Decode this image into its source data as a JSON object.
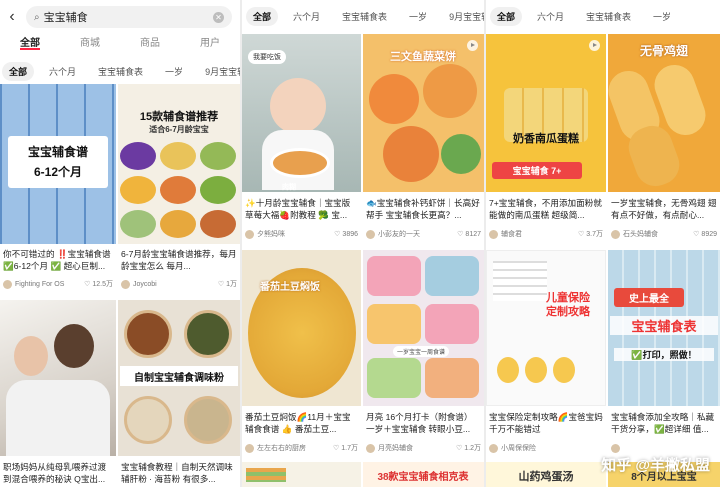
{
  "search": {
    "value": "宝宝辅食"
  },
  "tabs": [
    "全部",
    "商城",
    "商品",
    "用户"
  ],
  "chips": [
    "全部",
    "六个月",
    "宝宝辅食表",
    "一岁",
    "9月宝宝辅"
  ],
  "cards": {
    "c1": {
      "overlay": "宝宝辅食谱\n6-12个月",
      "caption": "你不可错过的 ‼️宝宝辅食谱 ✅6-12个月 ✅ 超心巨制...",
      "author": "Fighting For OS",
      "likes": "12.5万"
    },
    "c2": {
      "overlay": "15款辅食谱推荐",
      "overlay2": "适合6-7月龄宝宝",
      "caption": "6-7月龄宝宝辅食谱推荐，每月龄宝宝怎么 每月...",
      "author": "Joycobi",
      "likes": "1万"
    },
    "c3": {
      "caption": "职场妈妈从纯母乳喂养过渡到混合喂养的秘诀 Q宝出...",
      "author": "",
      "likes": ""
    },
    "c4": {
      "overlay": "自制宝宝辅食调味粉",
      "caption": "宝宝辅食教程｜自制天然调味辅肝粉 · 海苔粉 有很多...",
      "author": "",
      "likes": ""
    },
    "c5": {
      "bubble": "我要吃饭",
      "tag": "肉糊",
      "caption": "✨十月龄宝宝辅食｜宝宝版草莓大福🍓附教程 🥦 宝...",
      "author": "夕熊妈咪",
      "likes": "3896"
    },
    "c6": {
      "overlay": "三文鱼蔬菜饼",
      "caption": "🐟宝宝辅食补钙虾饼｜长高好帮手 宝宝辅食长更高？...",
      "author": "小彭友的一天",
      "likes": "8127"
    },
    "c7": {
      "overlay": "番茄土豆焖饭",
      "caption": "番茄土豆焖饭🌈11月＋宝宝辅食食谱 👍 番茄土豆...",
      "author": "左左右右的厨房",
      "likes": "1.7万"
    },
    "c8": {
      "overlay": "一岁宝宝一周食谱",
      "caption": "月亮 16个月打卡（附食谱）一岁＋宝宝辅食 转眼小豆...",
      "author": "月亮妈辅食",
      "likes": "1.2万"
    },
    "c9": {
      "overlay": "奶香南瓜蛋糕",
      "badge": "宝宝辅食 7+",
      "caption": "7+宝宝辅食，不用添加面粉就能做的南瓜蛋糕 超级简...",
      "author": "辅食君",
      "likes": "3.7万"
    },
    "c10": {
      "overlay": "无骨鸡翅",
      "caption": "一岁宝宝辅食，无骨鸡翅 翅有点不好做，有点耐心...",
      "author": "石头妈辅食",
      "likes": "8929"
    },
    "c11": {
      "overlay": "儿童保险\n定制攻略",
      "caption": "宝宝保险定制攻略🌈宝爸宝妈千万不能错过",
      "author": "小周保保险",
      "likes": ""
    },
    "c12": {
      "overlay": "史上最全",
      "overlay2": "宝宝辅食表",
      "overlay3": "✅打印，照做！",
      "caption": "宝宝辅食添加全攻略｜私藏干货分享，✅超详细 值...",
      "author": "",
      "likes": ""
    },
    "c13": {
      "overlay": "38款宝宝辅食相克表"
    },
    "c14": {
      "overlay": "山药鸡蛋汤"
    },
    "c15": {
      "overlay": "8个月以上宝宝"
    }
  },
  "watermark": "知乎 @羊撇私盟"
}
